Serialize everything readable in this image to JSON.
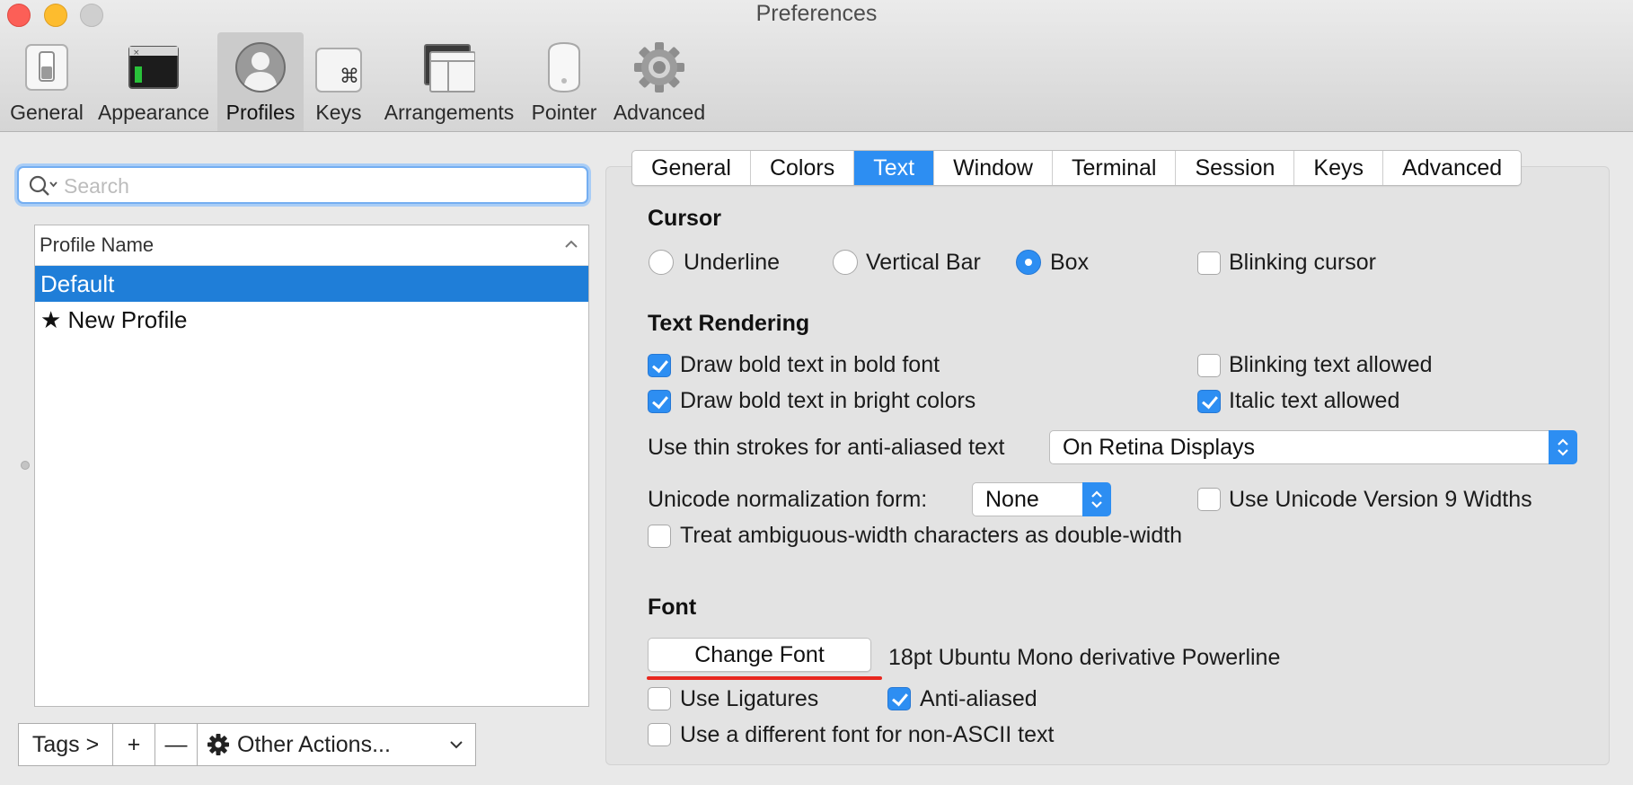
{
  "window": {
    "title": "Preferences"
  },
  "toolbar": {
    "items": [
      {
        "label": "General",
        "icon": "switch-icon"
      },
      {
        "label": "Appearance",
        "icon": "terminal-window-icon"
      },
      {
        "label": "Profiles",
        "icon": "user-silhouette-icon",
        "selected": true
      },
      {
        "label": "Keys",
        "icon": "command-key-icon"
      },
      {
        "label": "Arrangements",
        "icon": "window-arrangement-icon"
      },
      {
        "label": "Pointer",
        "icon": "mouse-icon"
      },
      {
        "label": "Advanced",
        "icon": "gear-icon"
      }
    ]
  },
  "sidebar": {
    "search": {
      "placeholder": "Search",
      "value": ""
    },
    "list_header": "Profile Name",
    "profiles": [
      {
        "name": "Default",
        "selected": true
      },
      {
        "name": "★ New Profile",
        "selected": false
      }
    ],
    "bottom_bar": {
      "tags": "Tags >",
      "add": "+",
      "remove": "—",
      "other_actions": "Other Actions..."
    }
  },
  "tabs": {
    "items": [
      "General",
      "Colors",
      "Text",
      "Window",
      "Terminal",
      "Session",
      "Keys",
      "Advanced"
    ],
    "active": "Text"
  },
  "cursor": {
    "title": "Cursor",
    "underline": "Underline",
    "vertical_bar": "Vertical Bar",
    "box": "Box",
    "selected": "Box",
    "blinking_cursor": {
      "label": "Blinking cursor",
      "checked": false
    }
  },
  "text_rendering": {
    "title": "Text Rendering",
    "bold_font": {
      "label": "Draw bold text in bold font",
      "checked": true
    },
    "bold_bright": {
      "label": "Draw bold text in bright colors",
      "checked": true
    },
    "blinking_text": {
      "label": "Blinking text allowed",
      "checked": false
    },
    "italic_text": {
      "label": "Italic text allowed",
      "checked": true
    },
    "thin_strokes_label": "Use thin strokes for anti-aliased text",
    "thin_strokes_value": "On Retina Displays",
    "unicode_norm_label": "Unicode normalization form:",
    "unicode_norm_value": "None",
    "unicode_v9": {
      "label": "Use Unicode Version 9 Widths",
      "checked": false
    },
    "ambiguous_width": {
      "label": "Treat ambiguous-width characters as double-width",
      "checked": false
    }
  },
  "font": {
    "title": "Font",
    "change_font_button": "Change Font",
    "current_font": "18pt Ubuntu Mono derivative Powerline",
    "ligatures": {
      "label": "Use Ligatures",
      "checked": false
    },
    "anti_aliased": {
      "label": "Anti-aliased",
      "checked": true
    },
    "non_ascii": {
      "label": "Use a different font for non-ASCII text",
      "checked": false
    }
  },
  "colors": {
    "accent": "#2d8ef2",
    "selection": "#1f7ed8",
    "annotation_underline": "#e8271f"
  }
}
